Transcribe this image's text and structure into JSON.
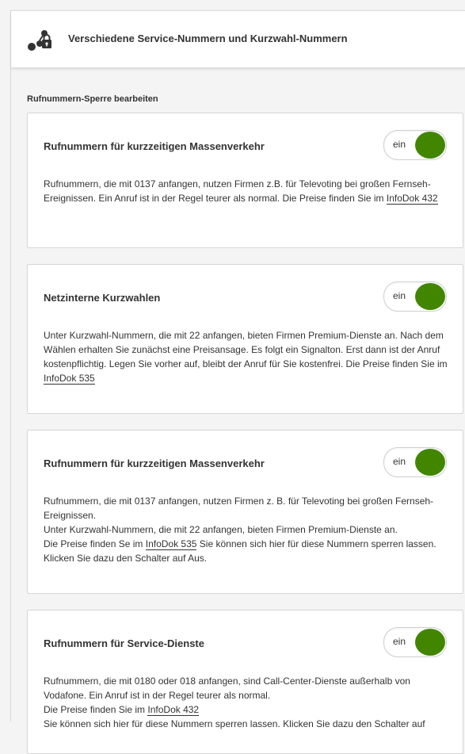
{
  "header": {
    "title": "Verschiedene Service-Nummern und Kurzwahl-Nummern",
    "icon": "lock-network-icon"
  },
  "section": {
    "title": "Rufnummern-Sperre bearbeiten"
  },
  "colors": {
    "toggle_on": "#428600"
  },
  "cards": [
    {
      "title": "Rufnummern für kurzzeitigen Massenverkehr",
      "toggle_label": "ein",
      "toggle_on": true,
      "lines": [
        "Rufnummern, die mit 0137 anfangen, nutzen Firmen z.B. für Televoting bei großen Fernseh-Ereignissen. Ein Anruf ist in der Regel teurer als normal. Die Preise finden Sie im "
      ],
      "link": "InfoDok 432",
      "after_link": ""
    },
    {
      "title": "Netzinterne Kurzwahlen",
      "toggle_label": "ein",
      "toggle_on": true,
      "lines": [
        "Unter Kurzwahl-Nummern, die mit 22 anfangen, bieten Firmen Premium-Dienste an. Nach dem Wählen erhalten Sie zunächst eine Preisansage. Es folgt ein Signalton. Erst dann ist der Anruf kostenpflichtig. Legen Sie vorher auf, bleibt der Anruf für Sie kostenfrei. Die Preise finden Sie im "
      ],
      "link": "InfoDok 535",
      "after_link": ""
    },
    {
      "title": "Rufnummern für kurzzeitigen Massenverkehr",
      "toggle_label": "ein",
      "toggle_on": true,
      "lines": [
        "Rufnummern, die mit 0137 anfangen, nutzen Firmen z. B. für Televoting bei großen Fernseh-Ereignissen.",
        "Unter Kurzwahl-Nummern, die mit 22 anfangen, bieten Firmen Premium-Dienste an.",
        "Die Preise finden Se im "
      ],
      "link": "InfoDok 535",
      "after_link": " Sie können sich hier für diese Nummern sperren lassen. Klicken Sie dazu den Schalter auf Aus."
    },
    {
      "title": "Rufnummern für Service-Dienste",
      "toggle_label": "ein",
      "toggle_on": true,
      "lines": [
        "Rufnummern, die mit 0180 oder 018 anfangen, sind Call-Center-Dienste außerhalb von Vodafone. Ein Anruf ist in der Regel teurer als normal.",
        "Die Preise finden Sie im "
      ],
      "link": "InfoDok 432",
      "after_link": "",
      "trailing_line": "Sie können sich hier für diese Nummern sperren lassen. Klicken Sie dazu den Schalter auf"
    }
  ]
}
